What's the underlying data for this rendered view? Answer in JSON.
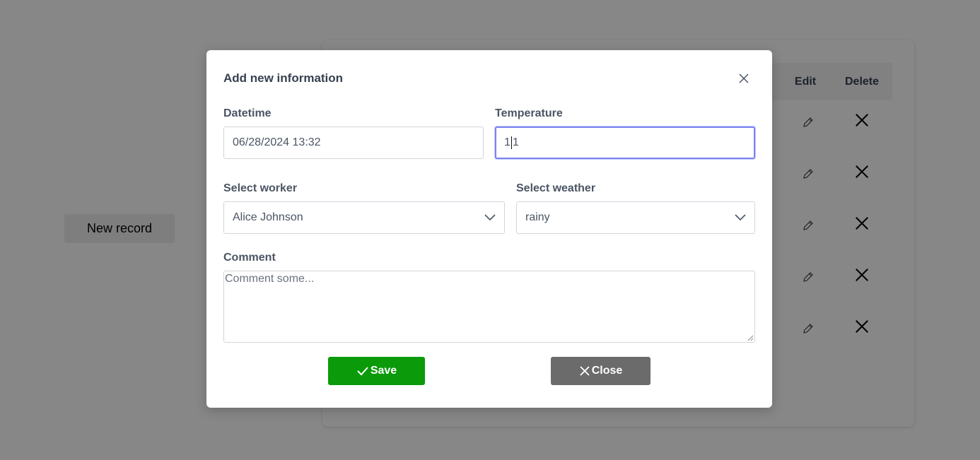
{
  "background": {
    "new_record_label": "New record",
    "table": {
      "columns": [
        "Edit",
        "Delete"
      ],
      "row_count": 5
    }
  },
  "modal": {
    "title": "Add new information",
    "fields": {
      "datetime": {
        "label": "Datetime",
        "value": "06/28/2024 13:32"
      },
      "temperature": {
        "label": "Temperature",
        "value_before_caret": "1",
        "value_after_caret": "1"
      },
      "worker": {
        "label": "Select worker",
        "selected": "Alice Johnson"
      },
      "weather": {
        "label": "Select weather",
        "selected": "rainy"
      },
      "comment": {
        "label": "Comment",
        "placeholder": "Comment some..."
      }
    },
    "buttons": {
      "save_label": "Save",
      "close_label": "Close"
    }
  },
  "colors": {
    "save": "#0a9a0a",
    "close": "#6b6b6b",
    "focus_ring": "#7c83f2",
    "overlay": "rgba(0,0,0,0.47)"
  },
  "icons": {
    "modal_close": "close-icon",
    "save": "check-icon",
    "close": "close-icon",
    "select": "chevron-down-icon",
    "row_edit": "pencil-icon",
    "row_delete": "close-icon"
  }
}
